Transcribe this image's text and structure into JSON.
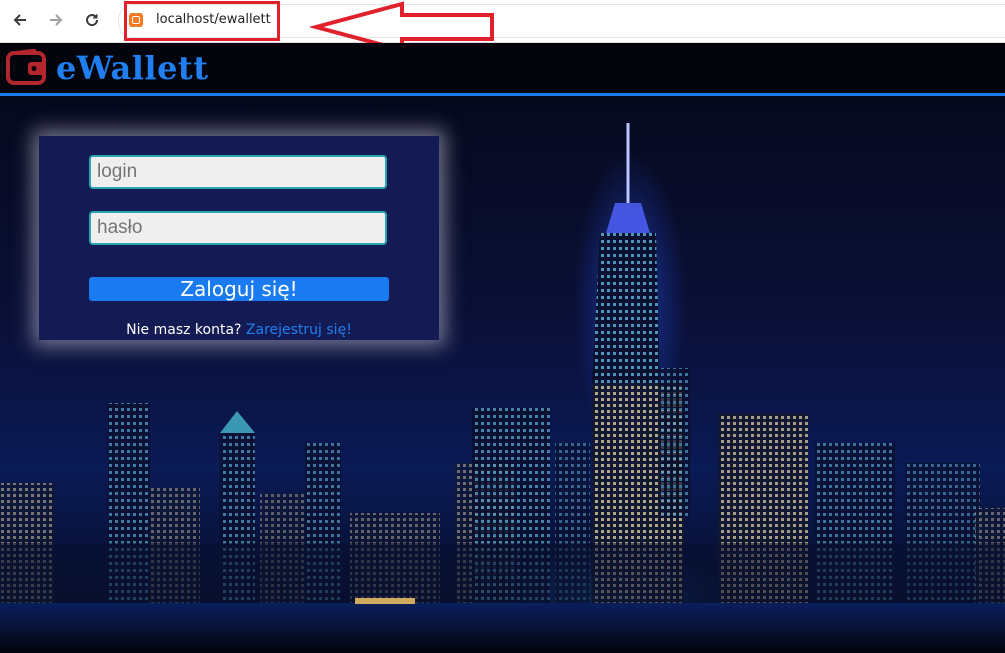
{
  "browser": {
    "url": "localhost/ewallett",
    "icons": {
      "back": "arrow-left-icon",
      "forward": "arrow-right-icon",
      "reload": "reload-icon",
      "site": "xampp-icon"
    }
  },
  "header": {
    "brand": "eWallett",
    "logo_icon": "wallet-icon"
  },
  "login": {
    "login_placeholder": "login",
    "password_placeholder": "hasło",
    "submit_label": "Zaloguj się!",
    "register_prompt": "Nie masz konta?",
    "register_link": "Zarejestruj się!"
  },
  "colors": {
    "brand": "#1f7ff0",
    "accent": "#1a7bf0",
    "annotation": "#e0212b",
    "panel": "#141a54",
    "logo_red": "#b3262e"
  }
}
